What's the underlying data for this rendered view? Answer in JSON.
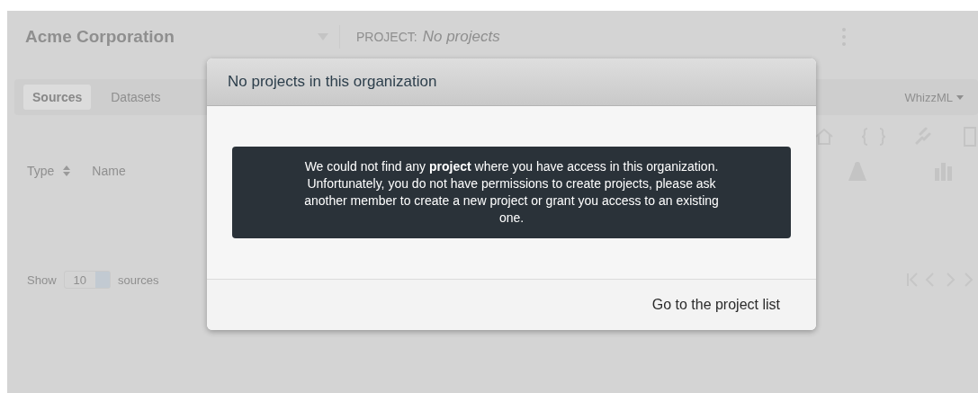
{
  "header": {
    "organization": "Acme Corporation",
    "project_label": "PROJECT:",
    "project_value": "No projects"
  },
  "tabs": [
    {
      "label": "Sources",
      "selected": true
    },
    {
      "label": "Datasets",
      "selected": false
    }
  ],
  "menu": {
    "label": "WhizzML"
  },
  "table": {
    "columns": [
      "Type",
      "Name"
    ]
  },
  "footer": {
    "show_label": "Show",
    "page_size": "10",
    "unit": "sources"
  },
  "dialog": {
    "title": "No projects in this organization",
    "message": "We could not find any **project** where you have access in this organization. Unfortunately, you do not have permissions to create projects, please ask another member to create a new project or grant you access to an existing one.",
    "action": "Go to the project list"
  }
}
